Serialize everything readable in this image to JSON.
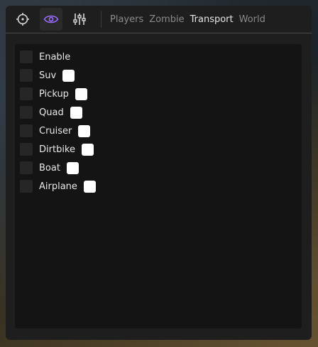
{
  "toolbar": {
    "icons": [
      "crosshair-icon",
      "eye-icon",
      "sliders-icon"
    ],
    "active_icon": "eye-icon",
    "accent_color": "#9b6bff"
  },
  "tabs": [
    {
      "label": "Players",
      "active": false
    },
    {
      "label": "Zombie",
      "active": false
    },
    {
      "label": "Transport",
      "active": true
    },
    {
      "label": "World",
      "active": false
    }
  ],
  "options": [
    {
      "label": "Enable",
      "checked": false,
      "has_color": false
    },
    {
      "label": "Suv",
      "checked": false,
      "has_color": true,
      "color": "#ffffff"
    },
    {
      "label": "Pickup",
      "checked": false,
      "has_color": true,
      "color": "#ffffff"
    },
    {
      "label": "Quad",
      "checked": false,
      "has_color": true,
      "color": "#ffffff"
    },
    {
      "label": "Cruiser",
      "checked": false,
      "has_color": true,
      "color": "#ffffff"
    },
    {
      "label": "Dirtbike",
      "checked": false,
      "has_color": true,
      "color": "#ffffff"
    },
    {
      "label": "Boat",
      "checked": false,
      "has_color": true,
      "color": "#ffffff"
    },
    {
      "label": "Airplane",
      "checked": false,
      "has_color": true,
      "color": "#ffffff"
    }
  ]
}
